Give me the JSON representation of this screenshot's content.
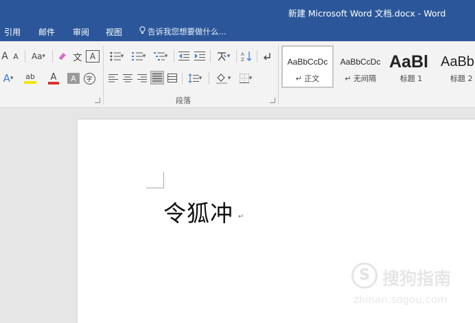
{
  "window": {
    "title": "新建 Microsoft Word 文档.docx - Word"
  },
  "tabs": [
    "引用",
    "邮件",
    "审阅",
    "视图"
  ],
  "tell_me": "告诉我您想要做什么...",
  "ribbon": {
    "font_group": {
      "row1": {
        "grow": "A",
        "shrink": "A",
        "change_case": "Aa",
        "ruby": "文",
        "border": "A"
      },
      "row2": {
        "effects": "A",
        "highlight": "ab",
        "font_color": "A",
        "shading": "A",
        "enclose": "字"
      },
      "highlight_color": "#f5e600",
      "font_color_bar": "#e03131"
    },
    "paragraph_group": {
      "label": "段落"
    },
    "styles": [
      {
        "sample": "AaBbCcDc",
        "name": "↵ 正文",
        "active": true
      },
      {
        "sample": "AaBbCcDc",
        "name": "↵ 无间隔",
        "active": false
      },
      {
        "sample": "AaBl",
        "name": "标题 1",
        "active": false
      },
      {
        "sample": "AaBb",
        "name": "标题 2",
        "active": false
      }
    ]
  },
  "document": {
    "text": "令狐冲",
    "paragraph_mark": "↵"
  },
  "watermark": {
    "logo": "S",
    "text": "搜狗指南",
    "url": "zhinan.sogou.com"
  },
  "colors": {
    "titlebar": "#2b579a",
    "ribbon": "#f3f3f3",
    "page": "#ffffff"
  }
}
